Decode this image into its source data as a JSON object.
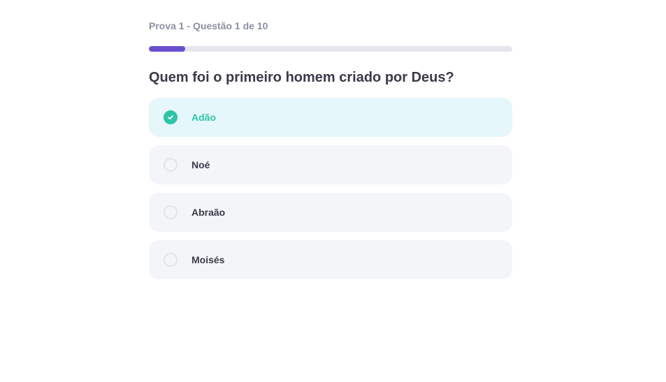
{
  "quiz": {
    "meta_label": "Prova 1 - Questão 1 de 10",
    "progress_fraction": 0.1,
    "question": "Quem foi o primeiro homem criado por Deus?",
    "options": [
      {
        "label": "Adão",
        "selected": true,
        "icon": "check-icon"
      },
      {
        "label": "Noé",
        "selected": false,
        "icon": "radio-icon"
      },
      {
        "label": "Abraão",
        "selected": false,
        "icon": "radio-icon"
      },
      {
        "label": "Moisés",
        "selected": false,
        "icon": "radio-icon"
      }
    ]
  },
  "colors": {
    "accent": "#6a4fd0",
    "selected": "#2ec4a7",
    "selected_bg": "#e6f7fb",
    "option_bg": "#f4f5f9",
    "text": "#3a3b48",
    "muted": "#8a8fa3"
  }
}
